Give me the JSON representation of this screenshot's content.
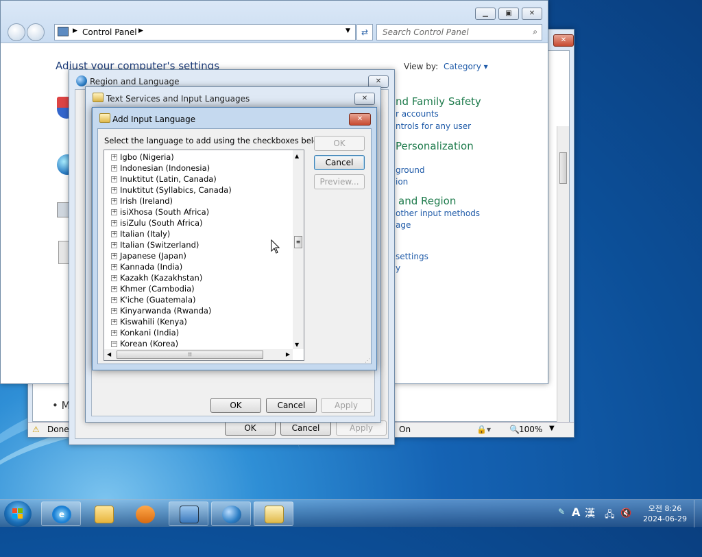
{
  "ie_window": {
    "status_text": "Done",
    "zone_text": "On",
    "zoom": "100%",
    "bullet_text": "• M"
  },
  "control_panel": {
    "breadcrumb": "Control Panel",
    "search_placeholder": "Search Control Panel",
    "heading": "Adjust your computer's settings",
    "view_by_label": "View by:",
    "view_by_value": "Category",
    "categories": [
      {
        "title": "nd Family Safety",
        "links": [
          "r accounts",
          "ntrols for any user"
        ]
      },
      {
        "title": "Personalization",
        "links": [
          "ground",
          "ion"
        ]
      },
      {
        "title": "and Region",
        "links": [
          "other input methods",
          "age"
        ]
      },
      {
        "title": "",
        "links": [
          "settings",
          "y"
        ]
      }
    ]
  },
  "region_language": {
    "title": "Region and Language",
    "ok": "OK",
    "cancel": "Cancel",
    "apply": "Apply"
  },
  "text_services": {
    "title": "Text Services and Input Languages",
    "ok": "OK",
    "cancel": "Cancel",
    "apply": "Apply"
  },
  "add_input_language": {
    "title": "Add Input Language",
    "instruction": "Select the language to add using the checkboxes below.",
    "ok": "OK",
    "cancel": "Cancel",
    "preview": "Preview...",
    "languages": [
      "Igbo (Nigeria)",
      "Indonesian (Indonesia)",
      "Inuktitut (Latin, Canada)",
      "Inuktitut (Syllabics, Canada)",
      "Irish (Ireland)",
      "isiXhosa (South Africa)",
      "isiZulu (South Africa)",
      "Italian (Italy)",
      "Italian (Switzerland)",
      "Japanese (Japan)",
      "Kannada (India)",
      "Kazakh (Kazakhstan)",
      "Khmer (Cambodia)",
      "K'iche (Guatemala)",
      "Kinyarwanda (Rwanda)",
      "Kiswahili (Kenya)",
      "Konkani (India)",
      "Korean (Korea)"
    ],
    "last_item_expanded": true
  },
  "taskbar": {
    "ime_mode": "A",
    "ime_hanja": "漢",
    "time": "오전 8:26",
    "date": "2024-06-29",
    "pinned": [
      "start-orb",
      "internet-explorer",
      "windows-explorer",
      "media-player",
      "control-panel",
      "region-language",
      "keyboard"
    ]
  }
}
